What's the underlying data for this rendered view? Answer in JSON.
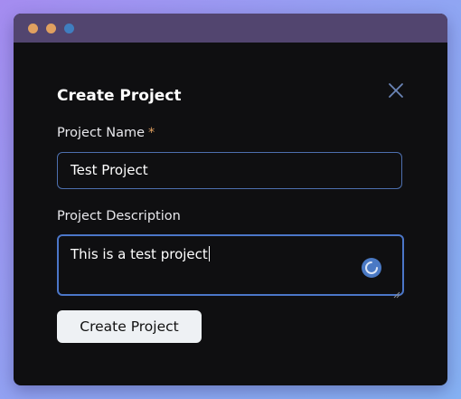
{
  "dialog": {
    "title": "Create Project",
    "close_icon": "close-icon"
  },
  "fields": {
    "name": {
      "label": "Project Name",
      "required_marker": "*",
      "value": "Test Project"
    },
    "description": {
      "label": "Project Description",
      "value": "This is a test project",
      "status_icon": "spinner-icon"
    }
  },
  "actions": {
    "submit_label": "Create Project"
  },
  "colors": {
    "background_gradient_start": "#a58cf0",
    "background_gradient_end": "#86b2f4",
    "titlebar": "#52456f",
    "window": "#0f0f11",
    "accent_border": "#4b76c8",
    "required_star": "#e0a060",
    "button_bg": "#eef1f4"
  }
}
